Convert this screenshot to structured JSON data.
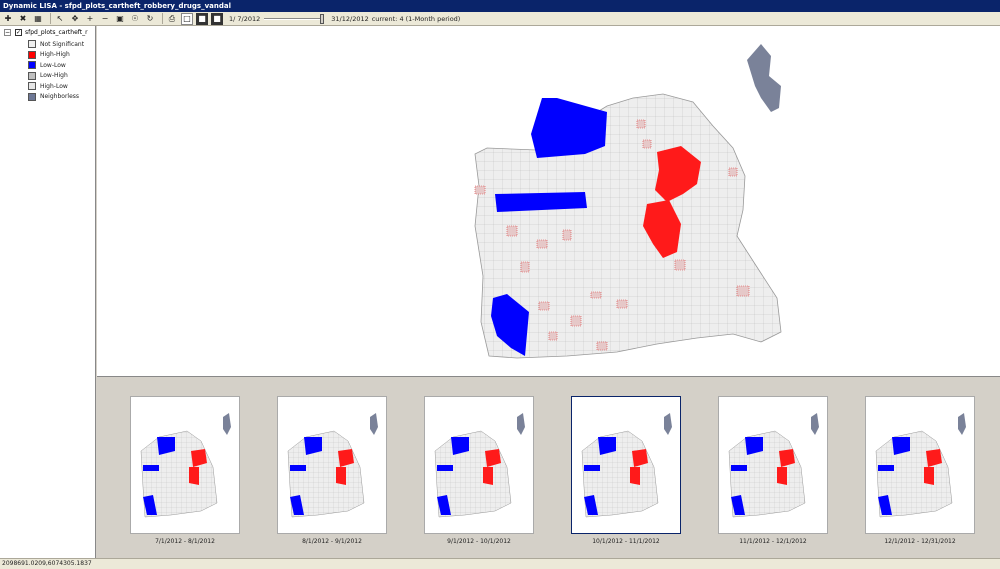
{
  "window": {
    "title": "Dynamic LISA - sfpd_plots_cartheft_robbery_drugs_vandal"
  },
  "toolbar": {
    "icons": [
      "add-layer-icon",
      "remove-layer-icon",
      "table-icon",
      "select-icon",
      "pan-icon",
      "zoom-in-icon",
      "zoom-out-icon",
      "full-extent-icon",
      "identify-icon",
      "refresh-icon",
      "print-icon",
      "page-icon",
      "dark-box-icon",
      "filled-box-icon"
    ],
    "start_date": "1/ 7/2012",
    "end_date": "31/12/2012",
    "current": "current: 4 (1-Month period)"
  },
  "legend": {
    "layer_name": "sfpd_plots_cartheft_r",
    "items": [
      {
        "label": "Not Significant",
        "color": "#f0f0f0"
      },
      {
        "label": "High-High",
        "color": "#ff0000"
      },
      {
        "label": "Low-Low",
        "color": "#0000ff"
      },
      {
        "label": "Low-High",
        "color": "#c0c0c0"
      },
      {
        "label": "High-Low",
        "color": "#e6e6e6"
      },
      {
        "label": "Neighborless",
        "color": "#6e7896"
      }
    ]
  },
  "colors": {
    "high_high": "#ff1a1a",
    "low_low": "#0000ff",
    "not_significant": "#eeeeee",
    "neighborless": "#7a8299",
    "selected_border": "#0a246a"
  },
  "thumbnails": [
    {
      "label": "7/1/2012 - 8/1/2012",
      "selected": false
    },
    {
      "label": "8/1/2012 - 9/1/2012",
      "selected": false
    },
    {
      "label": "9/1/2012 - 10/1/2012",
      "selected": false
    },
    {
      "label": "10/1/2012 - 11/1/2012",
      "selected": true
    },
    {
      "label": "11/1/2012 - 12/1/2012",
      "selected": false
    },
    {
      "label": "12/1/2012 - 12/31/2012",
      "selected": false
    }
  ],
  "status": {
    "coordinates": "2098691.0209,6074305.1837"
  }
}
